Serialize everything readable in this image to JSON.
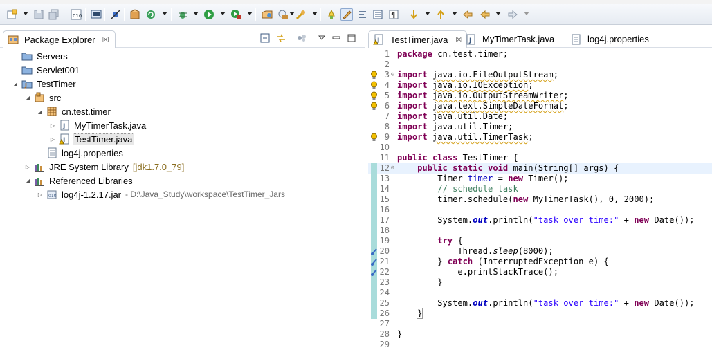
{
  "toolbar": {
    "icons": [
      "new-wizard-icon",
      "save-icon",
      "save-all-icon",
      "binary-icon",
      "console-icon",
      "skip-breakpoints-icon",
      "new-java-package-icon",
      "refresh-icon",
      "debug-icon",
      "run-icon",
      "run-external-icon",
      "new-java-class-icon",
      "open-type-icon",
      "search-icon",
      "toggle-mark-occurrences-icon",
      "toggle-highlight-icon",
      "show-whitespace-icon",
      "block-selection-icon",
      "next-annotation-icon",
      "previous-annotation-icon",
      "last-edit-location-icon",
      "back-icon",
      "forward-icon"
    ]
  },
  "explorer": {
    "tab_label": "Package Explorer",
    "tree": [
      {
        "label": "Servers",
        "icon": "folder-icon"
      },
      {
        "label": "Servlet001",
        "icon": "folder-icon"
      },
      {
        "label": "TestTimer",
        "icon": "java-project-icon"
      },
      {
        "label": "src",
        "icon": "source-folder-icon"
      },
      {
        "label": "cn.test.timer",
        "icon": "package-icon"
      },
      {
        "label": "MyTimerTask.java",
        "icon": "java-file-icon"
      },
      {
        "label": "TestTimer.java",
        "icon": "java-file-icon"
      },
      {
        "label": "log4j.properties",
        "icon": "properties-file-icon"
      },
      {
        "label": "JRE System Library",
        "decoration": "[jdk1.7.0_79]",
        "icon": "library-icon"
      },
      {
        "label": "Referenced Libraries",
        "icon": "library-icon"
      },
      {
        "label": "log4j-1.2.17.jar",
        "decoration": "- D:\\Java_Study\\workspace\\TestTimer_Jars",
        "icon": "jar-icon"
      }
    ]
  },
  "editor": {
    "tabs": [
      {
        "label": "TestTimer.java",
        "active": true
      },
      {
        "label": "MyTimerTask.java",
        "active": false
      },
      {
        "label": "log4j.properties",
        "active": false
      }
    ],
    "current_line": 12,
    "lines": [
      {
        "n": "1",
        "code": "package cn.test.timer;"
      },
      {
        "n": "2",
        "code": ""
      },
      {
        "n": "3",
        "code": "import java.io.FileOutputStream;",
        "marker": "warning",
        "fold": "⊖"
      },
      {
        "n": "4",
        "code": "import java.io.IOException;",
        "marker": "warning"
      },
      {
        "n": "5",
        "code": "import java.io.OutputStreamWriter;",
        "marker": "warning"
      },
      {
        "n": "6",
        "code": "import java.text.SimpleDateFormat;",
        "marker": "warning"
      },
      {
        "n": "7",
        "code": "import java.util.Date;"
      },
      {
        "n": "8",
        "code": "import java.util.Timer;"
      },
      {
        "n": "9",
        "code": "import java.util.TimerTask;",
        "marker": "warning"
      },
      {
        "n": "10",
        "code": ""
      },
      {
        "n": "11",
        "code": "public class TestTimer {"
      },
      {
        "n": "12",
        "code": "    public static void main(String[] args) {",
        "fold": "⊖"
      },
      {
        "n": "13",
        "code": "        Timer timer = new Timer();"
      },
      {
        "n": "14",
        "code": "        // schedule task"
      },
      {
        "n": "15",
        "code": "        timer.schedule(new MyTimerTask(), 0, 2000);"
      },
      {
        "n": "16",
        "code": ""
      },
      {
        "n": "17",
        "code": "        System.out.println(\"task over time:\" + new Date());"
      },
      {
        "n": "18",
        "code": ""
      },
      {
        "n": "19",
        "code": "        try {"
      },
      {
        "n": "20",
        "code": "            Thread.sleep(8000);",
        "marker": "task"
      },
      {
        "n": "21",
        "code": "        } catch (InterruptedException e) {",
        "marker": "task"
      },
      {
        "n": "22",
        "code": "            e.printStackTrace();",
        "marker": "task"
      },
      {
        "n": "23",
        "code": "        }"
      },
      {
        "n": "24",
        "code": ""
      },
      {
        "n": "25",
        "code": "        System.out.println(\"task over time:\" + new Date());"
      },
      {
        "n": "26",
        "code": "    }"
      },
      {
        "n": "27",
        "code": ""
      },
      {
        "n": "28",
        "code": "}"
      },
      {
        "n": "29",
        "code": ""
      }
    ]
  },
  "colors": {
    "keyword": "#7f0055",
    "string": "#2a00ff",
    "comment": "#3f7f5f",
    "field": "#0000c0",
    "line_highlight": "#e8f2fe",
    "quickdiff": "#a9dcdb",
    "decoration": "#8a6d1f"
  }
}
